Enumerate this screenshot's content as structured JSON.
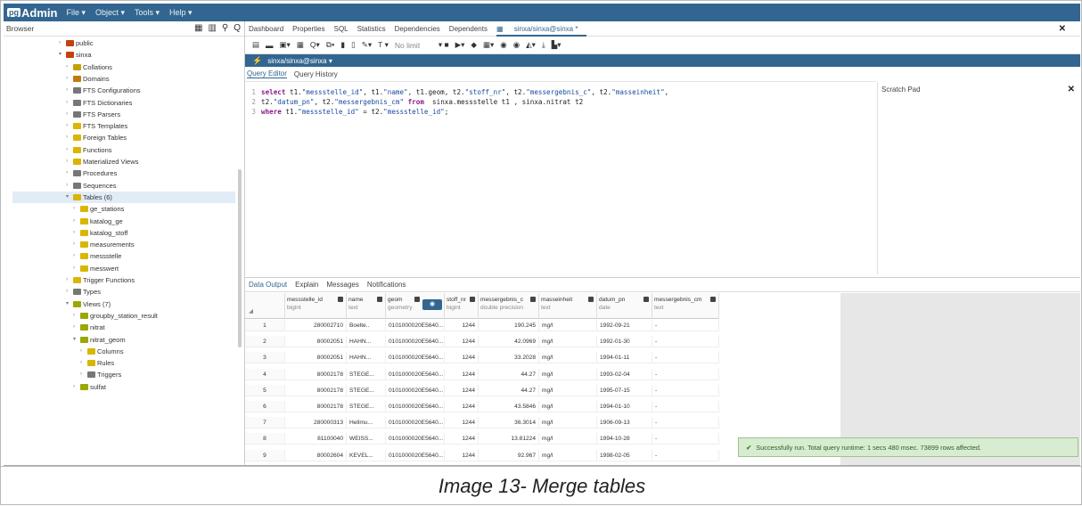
{
  "app": {
    "logo_pg": "pg",
    "logo_admin": "Admin",
    "menus": [
      "File ▾",
      "Object ▾",
      "Tools ▾",
      "Help ▾"
    ]
  },
  "browser": {
    "title": "Browser"
  },
  "tree": [
    {
      "label": "public",
      "icon": "schema-icon",
      "color": "#c2410c"
    },
    {
      "label": "sinxa",
      "icon": "schema-icon",
      "color": "#c2410c",
      "open": true
    },
    {
      "label": "Collations",
      "icon": "collations-icon",
      "color": "#c2a200"
    },
    {
      "label": "Domains",
      "icon": "domains-icon",
      "color": "#c07a10"
    },
    {
      "label": "FTS Configurations",
      "icon": "fts-icon",
      "color": "#777"
    },
    {
      "label": "FTS Dictionaries",
      "icon": "fts-icon",
      "color": "#777"
    },
    {
      "label": "FTS Parsers",
      "icon": "fts-icon",
      "color": "#777"
    },
    {
      "label": "FTS Templates",
      "icon": "fts-icon",
      "color": "#d9b600"
    },
    {
      "label": "Foreign Tables",
      "icon": "table-icon",
      "color": "#d9b600"
    },
    {
      "label": "Functions",
      "icon": "function-icon",
      "color": "#d9b600"
    },
    {
      "label": "Materialized Views",
      "icon": "view-icon",
      "color": "#d9b600"
    },
    {
      "label": "Procedures",
      "icon": "procedure-icon",
      "color": "#777"
    },
    {
      "label": "Sequences",
      "icon": "sequence-icon",
      "color": "#777"
    },
    {
      "label": "Tables (6)",
      "icon": "tables-icon",
      "color": "#d9b600",
      "open": true,
      "selected": true
    },
    {
      "label": "ge_stations",
      "icon": "table-icon",
      "color": "#d9b600"
    },
    {
      "label": "katalog_ge",
      "icon": "table-icon",
      "color": "#d9b600"
    },
    {
      "label": "katalog_stoff",
      "icon": "table-icon",
      "color": "#d9b600"
    },
    {
      "label": "measurements",
      "icon": "table-icon",
      "color": "#d9b600"
    },
    {
      "label": "messstelle",
      "icon": "table-icon",
      "color": "#d9b600"
    },
    {
      "label": "messwert",
      "icon": "table-icon",
      "color": "#d9b600"
    },
    {
      "label": "Trigger Functions",
      "icon": "trigger-icon",
      "color": "#d9b600"
    },
    {
      "label": "Types",
      "icon": "type-icon",
      "color": "#777"
    },
    {
      "label": "Views (7)",
      "icon": "views-icon",
      "color": "#9aa800",
      "open": true
    },
    {
      "label": "groupby_station_result",
      "icon": "view-icon",
      "color": "#9aa800"
    },
    {
      "label": "nitrat",
      "icon": "view-icon",
      "color": "#9aa800"
    },
    {
      "label": "nitrat_geom",
      "icon": "view-icon",
      "color": "#9aa800",
      "open": true
    },
    {
      "label": "Columns",
      "icon": "columns-icon",
      "color": "#d9b600"
    },
    {
      "label": "Rules",
      "icon": "rules-icon",
      "color": "#d9b600"
    },
    {
      "label": "Triggers",
      "icon": "triggers-icon",
      "color": "#777"
    },
    {
      "label": "sulfat",
      "icon": "view-icon",
      "color": "#9aa800"
    }
  ],
  "tabs": [
    "Dashboard",
    "Properties",
    "SQL",
    "Statistics",
    "Dependencies",
    "Dependents"
  ],
  "active_tab": "sinxa/sinxa@sinxa *",
  "toolbar_limit": "No limit",
  "connection": "sinxa/sinxa@sinxa ▾",
  "query_tabs": [
    "Query Editor",
    "Query History"
  ],
  "scratch_pad": "Scratch Pad",
  "sql_lines": [
    {
      "n": "1",
      "parts": [
        [
          "kw",
          "select "
        ],
        [
          "tx",
          "t1."
        ],
        [
          "st",
          "\"messstelle_id\""
        ],
        [
          "tx",
          ", t1."
        ],
        [
          "st",
          "\"name\""
        ],
        [
          "tx",
          ", t1.geom, t2."
        ],
        [
          "st",
          "\"stoff_nr\""
        ],
        [
          "tx",
          ", t2."
        ],
        [
          "st",
          "\"messergebnis_c\""
        ],
        [
          "tx",
          ", t2."
        ],
        [
          "st",
          "\"masseinheit\""
        ],
        [
          "tx",
          ","
        ]
      ]
    },
    {
      "n": "2",
      "parts": [
        [
          "tx",
          "t2."
        ],
        [
          "st",
          "\"datum_pn\""
        ],
        [
          "tx",
          ", t2."
        ],
        [
          "st",
          "\"messergebnis_cm\""
        ],
        [
          "tx",
          " "
        ],
        [
          "kw",
          "from"
        ],
        [
          "tx",
          "  sinxa.messstelle t1 , sinxa.nitrat t2"
        ]
      ]
    },
    {
      "n": "3",
      "parts": [
        [
          "kw",
          "where"
        ],
        [
          "tx",
          " t1."
        ],
        [
          "st",
          "\"messstelle_id\""
        ],
        [
          "tx",
          " = t2."
        ],
        [
          "st",
          "\"messstelle_id\""
        ],
        [
          "tx",
          ";"
        ]
      ]
    }
  ],
  "result_tabs": [
    "Data Output",
    "Explain",
    "Messages",
    "Notifications"
  ],
  "columns": [
    {
      "name": "messstelle_id",
      "type": "bigint"
    },
    {
      "name": "name",
      "type": "text"
    },
    {
      "name": "geom",
      "type": "geometry"
    },
    {
      "name": "stoff_nr",
      "type": "bigint"
    },
    {
      "name": "messergebnis_c",
      "type": "double precision"
    },
    {
      "name": "masseinheit",
      "type": "text"
    },
    {
      "name": "datum_pn",
      "type": "date"
    },
    {
      "name": "messergebnis_cm",
      "type": "text"
    }
  ],
  "rows": [
    [
      "1",
      "280002710",
      "Boelte..",
      "0101000020E5640...",
      "1244",
      "190.245",
      "mg/l",
      "1992-09-21",
      "-"
    ],
    [
      "2",
      "80002051",
      "HAHN...",
      "0101000020E5640...",
      "1244",
      "42.0969",
      "mg/l",
      "1992-01-30",
      "-"
    ],
    [
      "3",
      "80002051",
      "HAHN...",
      "0101000020E5640...",
      "1244",
      "33.2028",
      "mg/l",
      "1994-01-11",
      "-"
    ],
    [
      "4",
      "80002178",
      "STEGE...",
      "0101000020E5640...",
      "1244",
      "44.27",
      "mg/l",
      "1993-02-04",
      "-"
    ],
    [
      "5",
      "80002178",
      "STEGE...",
      "0101000020E5640...",
      "1244",
      "44.27",
      "mg/l",
      "1995-07-15",
      "-"
    ],
    [
      "6",
      "80002178",
      "STEGE...",
      "0101000020E5640...",
      "1244",
      "43.5846",
      "mg/l",
      "1994-01-10",
      "-"
    ],
    [
      "7",
      "280000313",
      "Hellmu...",
      "0101000020E5640...",
      "1244",
      "36.3014",
      "mg/l",
      "1906-09-13",
      "-"
    ],
    [
      "8",
      "81100040",
      "WEISS...",
      "0101000020E5640...",
      "1244",
      "13.81224",
      "mg/l",
      "1994-10-28",
      "-"
    ],
    [
      "9",
      "80002604",
      "KEVEL...",
      "0101000020E5640...",
      "1244",
      "92.967",
      "mg/l",
      "1998-02-05",
      "-"
    ]
  ],
  "toast": "Successfully run. Total query runtime: 1 secs 480 msec. 73899 rows affected.",
  "caption": "Image 13- Merge tables"
}
